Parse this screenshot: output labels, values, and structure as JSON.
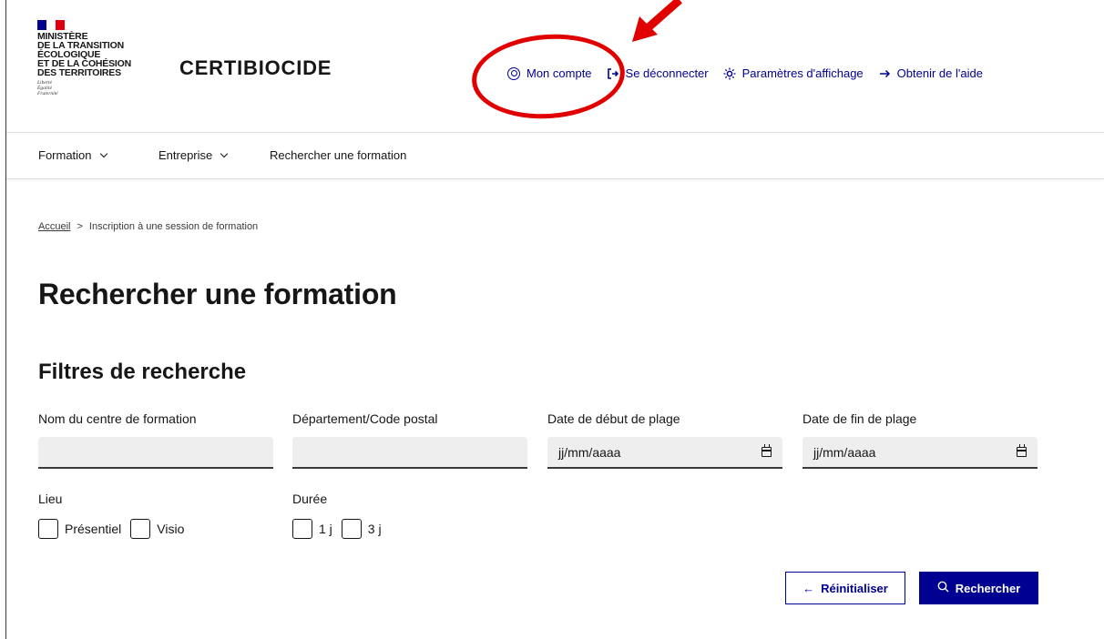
{
  "header": {
    "logo": {
      "ministry_lines": [
        "MINISTÈRE",
        "DE LA TRANSITION",
        "ÉCOLOGIQUE",
        "ET DE LA COHÉSION",
        "DES TERRITOIRES"
      ],
      "motto_lines": [
        "Liberté",
        "Égalité",
        "Fraternité"
      ]
    },
    "service_title": "CERTIBIOCIDE",
    "tools": [
      {
        "label": "Mon compte",
        "icon": "user-circle-icon"
      },
      {
        "label": "Se déconnecter",
        "icon": "logout-icon"
      },
      {
        "label": "Paramètres d'affichage",
        "icon": "sun-icon"
      },
      {
        "label": "Obtenir de l'aide",
        "icon": "arrow-right-icon"
      }
    ]
  },
  "nav": {
    "items": [
      {
        "label": "Formation"
      },
      {
        "label": "Entreprise"
      },
      {
        "label": "Rechercher une formation"
      }
    ]
  },
  "breadcrumb": {
    "home": "Accueil",
    "current": "Inscription à une session de formation"
  },
  "main": {
    "title": "Rechercher une formation",
    "filters_title": "Filtres de recherche",
    "fields": {
      "centre": {
        "label": "Nom du centre de formation",
        "value": ""
      },
      "departement": {
        "label": "Département/Code postal",
        "value": ""
      },
      "date_debut": {
        "label": "Date de début de plage",
        "placeholder": "jj/mm/aaaa"
      },
      "date_fin": {
        "label": "Date de fin de plage",
        "placeholder": "jj/mm/aaaa"
      }
    },
    "lieu": {
      "label": "Lieu",
      "options": [
        "Présentiel",
        "Visio"
      ]
    },
    "duree": {
      "label": "Durée",
      "options": [
        "1 j",
        "3 j"
      ]
    },
    "buttons": {
      "reset": "Réinitialiser",
      "search": "Rechercher"
    }
  },
  "colors": {
    "accent": "#000091",
    "annotation": "#e00000",
    "flag_blue": "#000091",
    "flag_red": "#e1000f"
  }
}
